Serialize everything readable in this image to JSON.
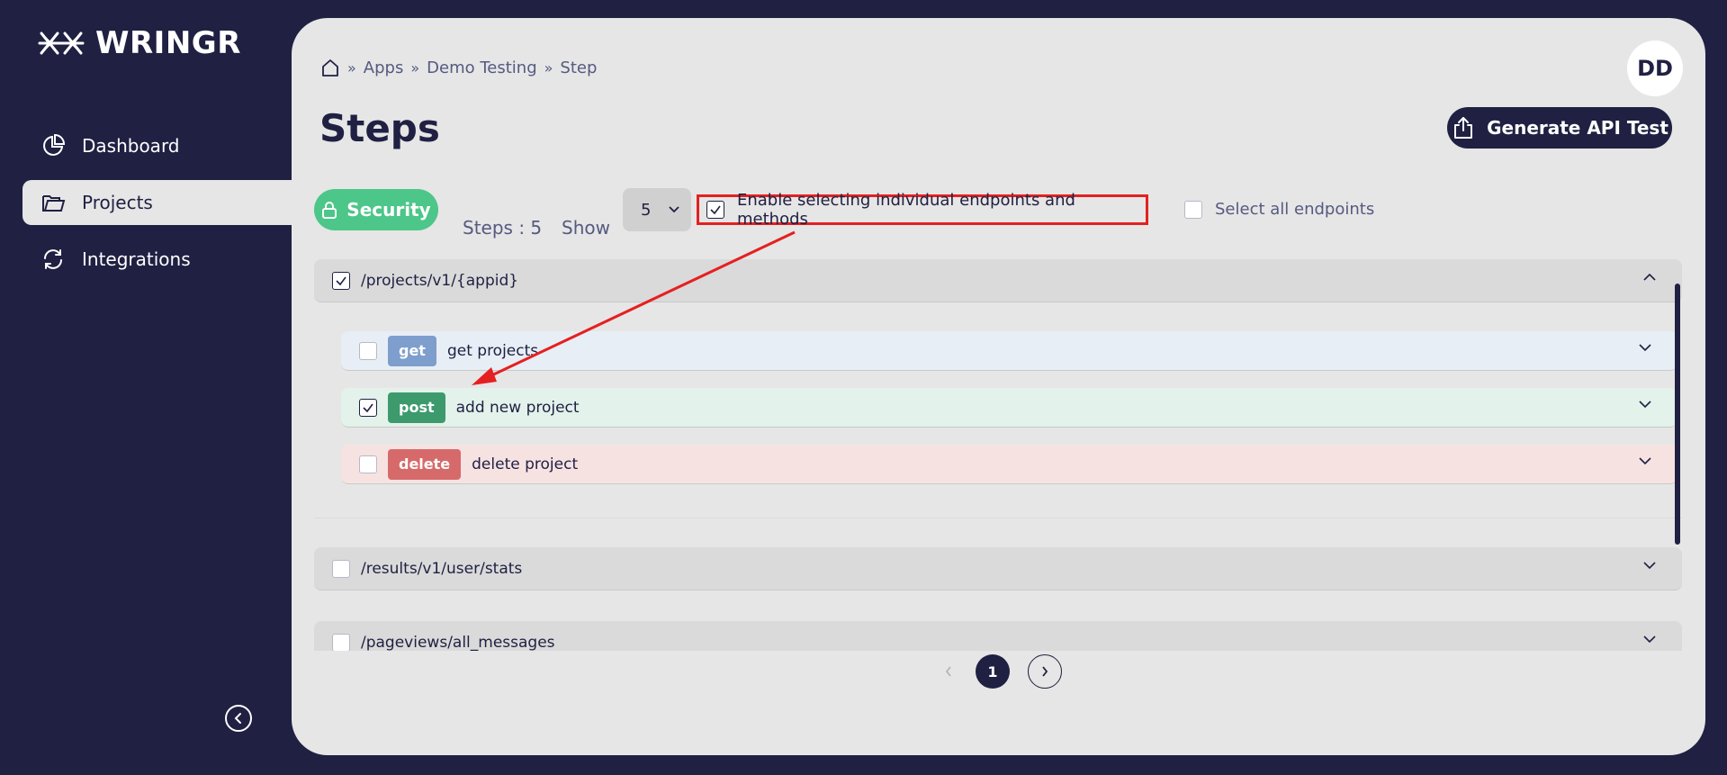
{
  "brand": {
    "name": "WRINGR"
  },
  "sidebar": {
    "items": [
      {
        "label": "Dashboard",
        "icon": "pie-chart-icon"
      },
      {
        "label": "Projects",
        "icon": "folder-icon",
        "active": true
      },
      {
        "label": "Integrations",
        "icon": "refresh-icon"
      }
    ]
  },
  "header": {
    "breadcrumb": [
      "Apps",
      "Demo Testing",
      "Step"
    ],
    "title": "Steps",
    "avatar": "DD",
    "generate_label": "Generate API Test"
  },
  "toolbar": {
    "security_label": "Security",
    "steps_count": "Steps : 5",
    "show_label": "Show",
    "show_value": "5",
    "enable_label": "Enable selecting individual endpoints and methods",
    "enable_checked": true,
    "select_all_label": "Select all endpoints",
    "select_all_checked": false
  },
  "endpoints": [
    {
      "path": "/projects/v1/{appid}",
      "checked": true,
      "expanded": true,
      "methods": [
        {
          "method": "get",
          "label": "get projects",
          "checked": false
        },
        {
          "method": "post",
          "label": "add new project",
          "checked": true
        },
        {
          "method": "delete",
          "label": "delete project",
          "checked": false
        }
      ]
    },
    {
      "path": "/results/v1/user/stats",
      "checked": false,
      "expanded": false
    },
    {
      "path": "/pageviews/all_messages",
      "checked": false,
      "expanded": false
    }
  ],
  "pagination": {
    "current": "1"
  },
  "colors": {
    "navy": "#1f2042",
    "security_green": "#4cc689",
    "get": "#7e9ecd",
    "post": "#3d9a6d",
    "delete": "#d66a6a",
    "annotation_red": "#e52020"
  }
}
